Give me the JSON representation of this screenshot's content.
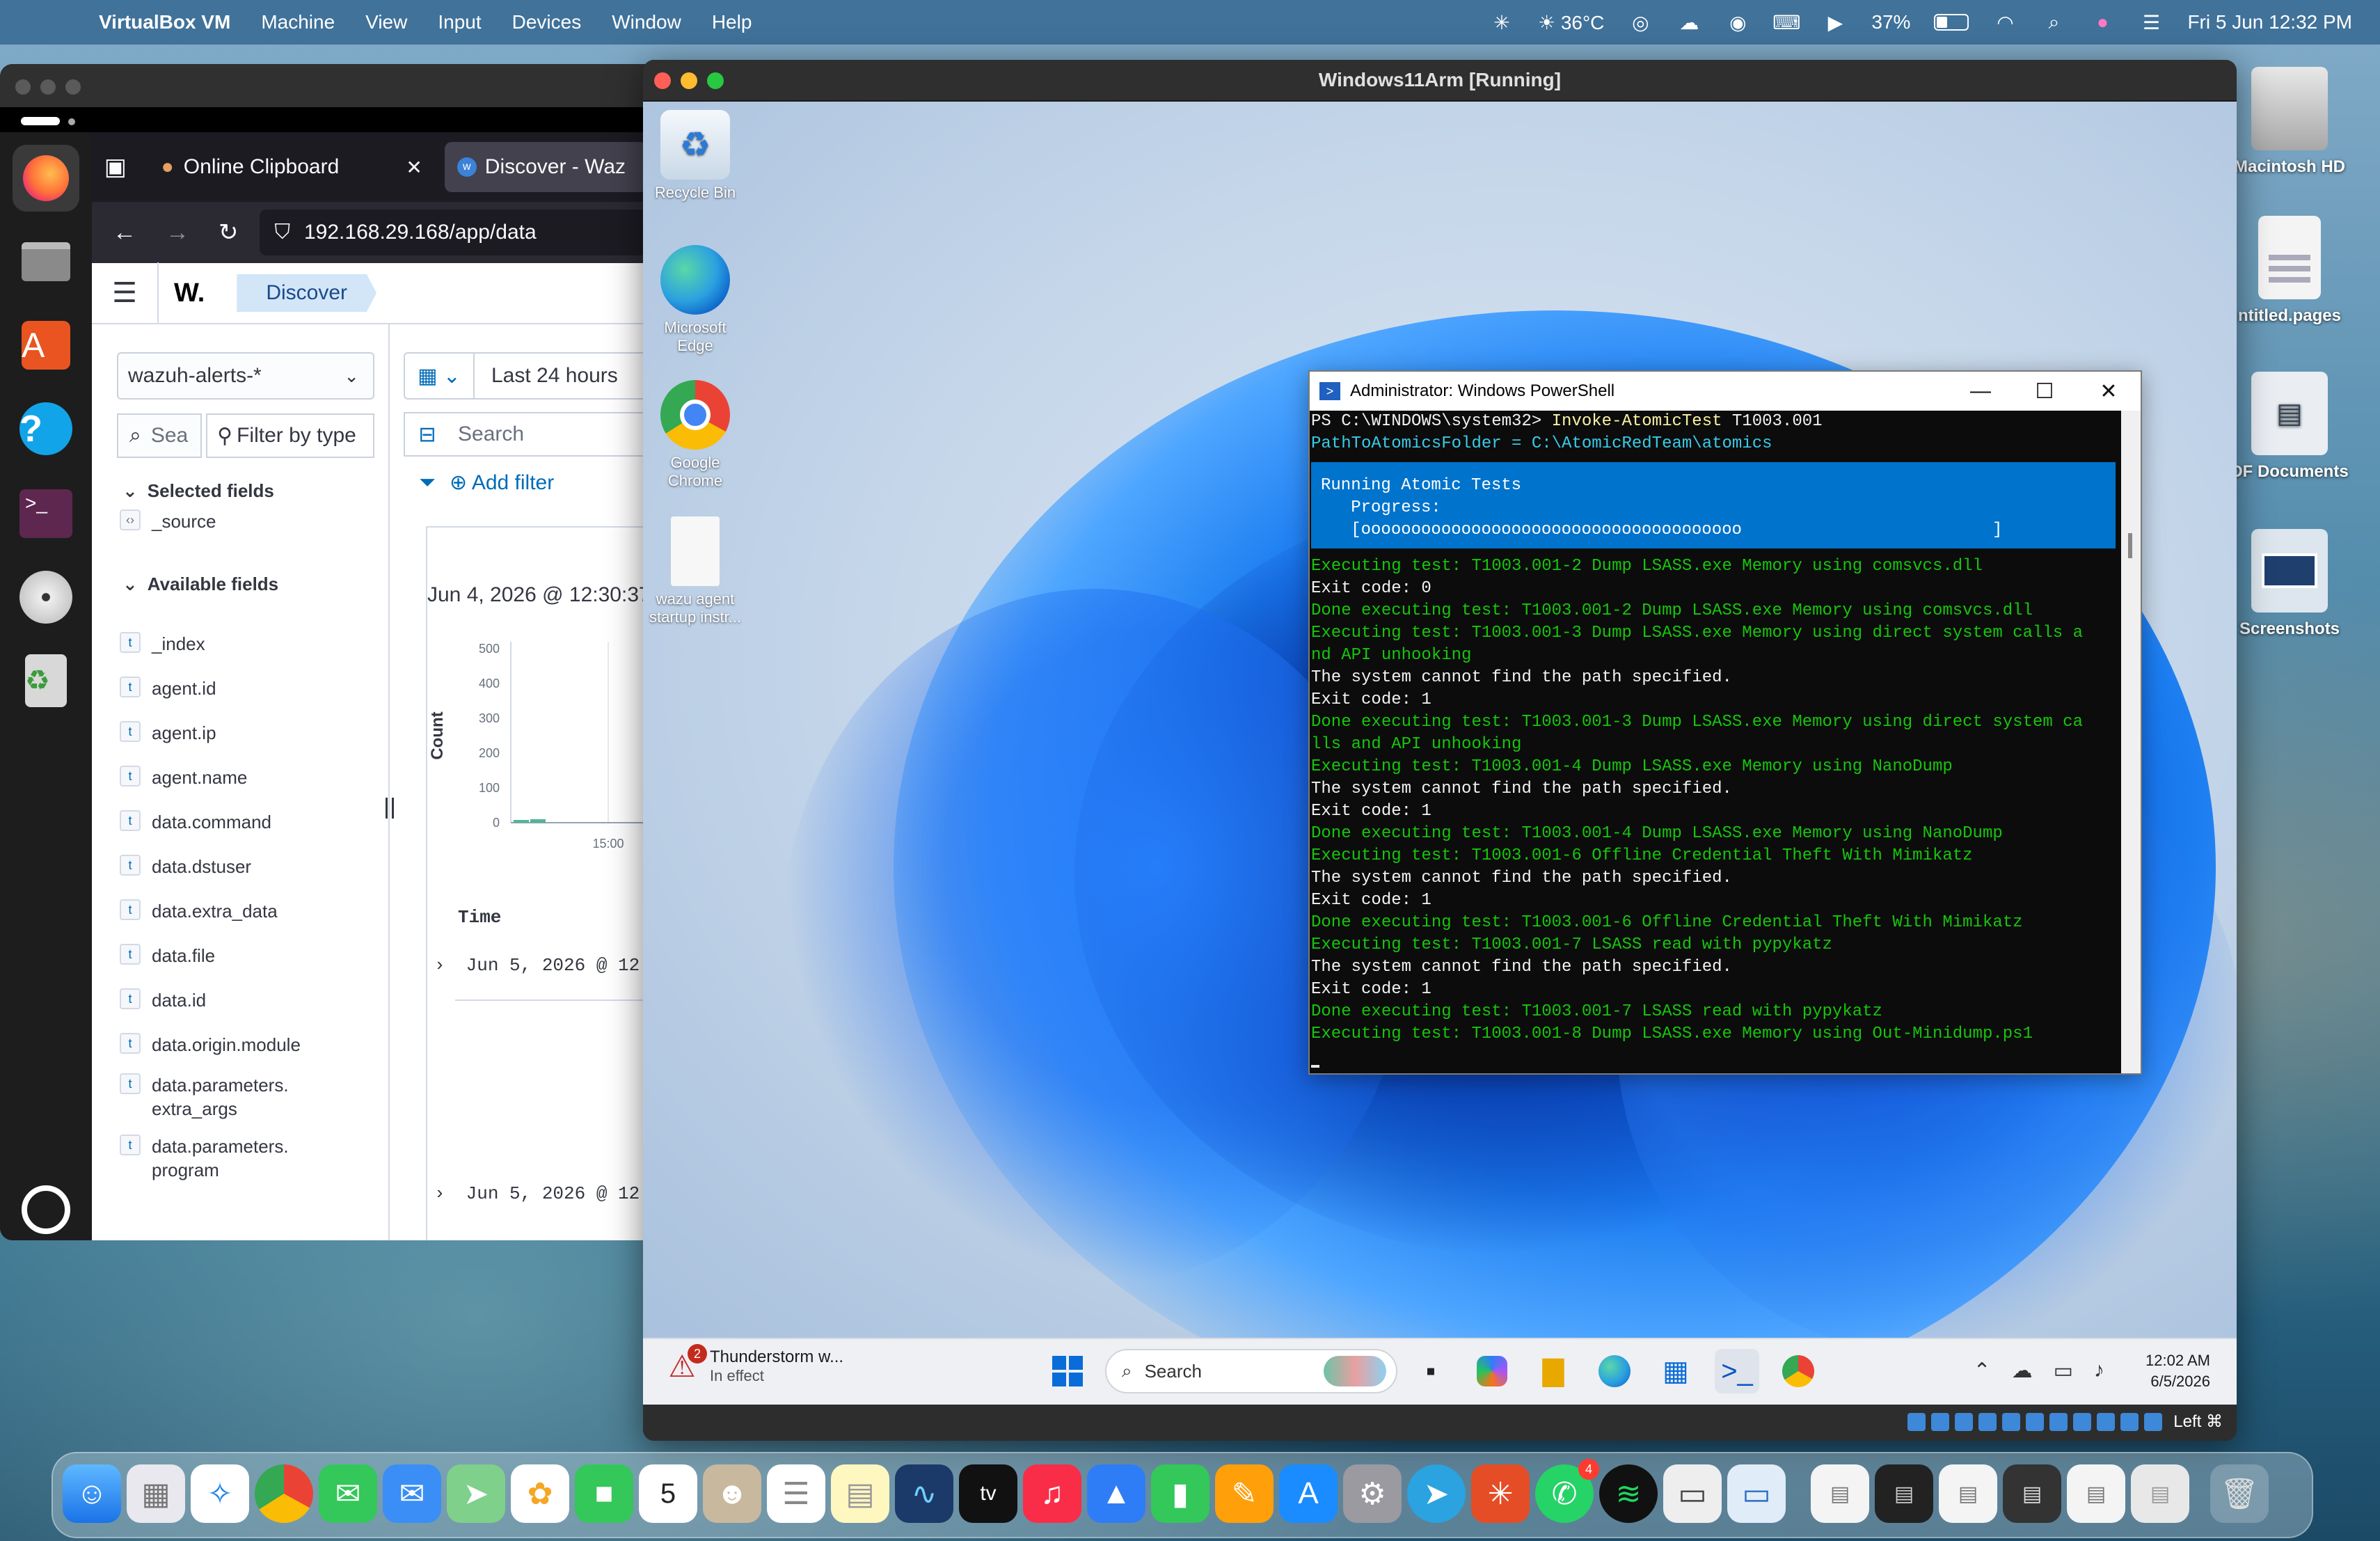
{
  "menubar": {
    "app_name": "VirtualBox VM",
    "menus": [
      "Machine",
      "View",
      "Input",
      "Devices",
      "Window",
      "Help"
    ],
    "weather": "☀ 36°C",
    "battery_pct": "37%",
    "datetime": "Fri 5 Jun  12:32 PM"
  },
  "firefox": {
    "tabs": [
      {
        "label": "Online Clipboard",
        "active": false
      },
      {
        "label": "Discover - Waz",
        "active": true
      }
    ],
    "url": "192.168.29.168/app/data"
  },
  "wazuh": {
    "logo": "W.",
    "breadcrumb": "Discover",
    "index_pattern": "wazuh-alerts-*",
    "search_placeholder": "Sea",
    "filter_by_type": "Filter by type",
    "selected_fields_label": "Selected fields",
    "selected_fields": [
      "_source"
    ],
    "available_fields_label": "Available fields",
    "available_fields": [
      "_index",
      "agent.id",
      "agent.ip",
      "agent.name",
      "data.command",
      "data.dstuser",
      "data.extra_data",
      "data.file",
      "data.id",
      "data.origin.module",
      "data.parameters.\nextra_args",
      "data.parameters.\nprogram"
    ],
    "date_range": "Last 24 hours",
    "search_label": "Search",
    "add_filter": "Add filter",
    "chart_timestamp": "Jun 4, 2026 @ 12:30:37",
    "count_label": "Count",
    "time_header": "Time",
    "rows": [
      "Jun 5, 2026 @ 12",
      "Jun 5, 2026 @ 12"
    ]
  },
  "chart_data": {
    "type": "bar",
    "ylabel": "Count",
    "ylim": [
      0,
      500
    ],
    "y_ticks": [
      "500",
      "400",
      "300",
      "200",
      "100",
      "0"
    ],
    "x_ticks": [
      "15:00"
    ],
    "values": [
      8,
      10
    ]
  },
  "vm": {
    "title": "Windows11Arm [Running]",
    "host_key": "Left ⌘"
  },
  "windows": {
    "desktop_icons": [
      "Recycle Bin",
      "Microsoft\nEdge",
      "Google\nChrome",
      "wazu agent\nstartup instr..."
    ],
    "weather_title": "Thunderstorm w...",
    "weather_sub": "In effect",
    "weather_badge": "2",
    "search_label": "Search",
    "clock_time": "12:02 AM",
    "clock_date": "6/5/2026"
  },
  "powershell": {
    "title": "Administrator: Windows PowerShell",
    "prompt": "PS C:\\WINDOWS\\system32> ",
    "command": "Invoke-AtomicTest",
    "command_arg": " T1003.001",
    "path_line": "PathToAtomicsFolder = C:\\AtomicRedTeam\\atomics",
    "progress_title": "Running Atomic Tests",
    "progress_label": "   Progress:",
    "progress_bar": "   [oooooooooooooooooooooooooooooooooooooo                         ]",
    "lines": [
      {
        "cls": "g",
        "text": "Executing test: T1003.001-2 Dump LSASS.exe Memory using comsvcs.dll"
      },
      {
        "cls": "w",
        "text": "Exit code: 0"
      },
      {
        "cls": "g",
        "text": "Done executing test: T1003.001-2 Dump LSASS.exe Memory using comsvcs.dll"
      },
      {
        "cls": "g",
        "text": "Executing test: T1003.001-3 Dump LSASS.exe Memory using direct system calls a"
      },
      {
        "cls": "g",
        "text": "nd API unhooking"
      },
      {
        "cls": "w",
        "text": "The system cannot find the path specified."
      },
      {
        "cls": "w",
        "text": "Exit code: 1"
      },
      {
        "cls": "g",
        "text": "Done executing test: T1003.001-3 Dump LSASS.exe Memory using direct system ca"
      },
      {
        "cls": "g",
        "text": "lls and API unhooking"
      },
      {
        "cls": "g",
        "text": "Executing test: T1003.001-4 Dump LSASS.exe Memory using NanoDump"
      },
      {
        "cls": "w",
        "text": "The system cannot find the path specified."
      },
      {
        "cls": "w",
        "text": "Exit code: 1"
      },
      {
        "cls": "g",
        "text": "Done executing test: T1003.001-4 Dump LSASS.exe Memory using NanoDump"
      },
      {
        "cls": "g",
        "text": "Executing test: T1003.001-6 Offline Credential Theft With Mimikatz"
      },
      {
        "cls": "w",
        "text": "The system cannot find the path specified."
      },
      {
        "cls": "w",
        "text": "Exit code: 1"
      },
      {
        "cls": "g",
        "text": "Done executing test: T1003.001-6 Offline Credential Theft With Mimikatz"
      },
      {
        "cls": "g",
        "text": "Executing test: T1003.001-7 LSASS read with pypykatz"
      },
      {
        "cls": "w",
        "text": "The system cannot find the path specified."
      },
      {
        "cls": "w",
        "text": "Exit code: 1"
      },
      {
        "cls": "g",
        "text": "Done executing test: T1003.001-7 LSASS read with pypykatz"
      },
      {
        "cls": "g",
        "text": "Executing test: T1003.001-8 Dump LSASS.exe Memory using Out-Minidump.ps1"
      }
    ]
  },
  "mac_desktop": {
    "icons": [
      "Macintosh HD",
      "ntitled.pages",
      "DF Documents",
      "Screenshots"
    ]
  },
  "dock": {
    "calendar_day": "5",
    "whatsapp_badge": "4"
  },
  "colors": {
    "wazuh_blue": "#006bb8",
    "ps_green": "#16c60c",
    "ps_progress": "#0073cc"
  }
}
